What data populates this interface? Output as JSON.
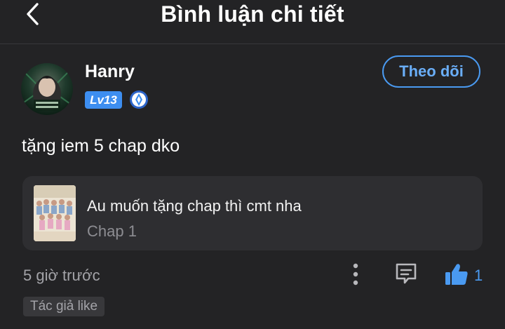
{
  "header": {
    "title": "Bình luận chi tiết",
    "back_icon": "chevron-left-icon"
  },
  "user": {
    "name": "Hanry",
    "level": "Lv13",
    "rank_icon": "rank-emblem-icon",
    "follow_label": "Theo dõi"
  },
  "comment": {
    "text": "tặng iem 5 chap dko"
  },
  "quote": {
    "title": "Au muốn tặng chap thì cmt nha",
    "subtitle": "Chap 1"
  },
  "footer": {
    "time": "5 giờ trước",
    "like_count": "1",
    "author_tag": "Tác giả like"
  },
  "colors": {
    "background": "#232325",
    "accent": "#4a9af1",
    "card": "#2e2e31",
    "muted_text": "#a3a3a8"
  }
}
